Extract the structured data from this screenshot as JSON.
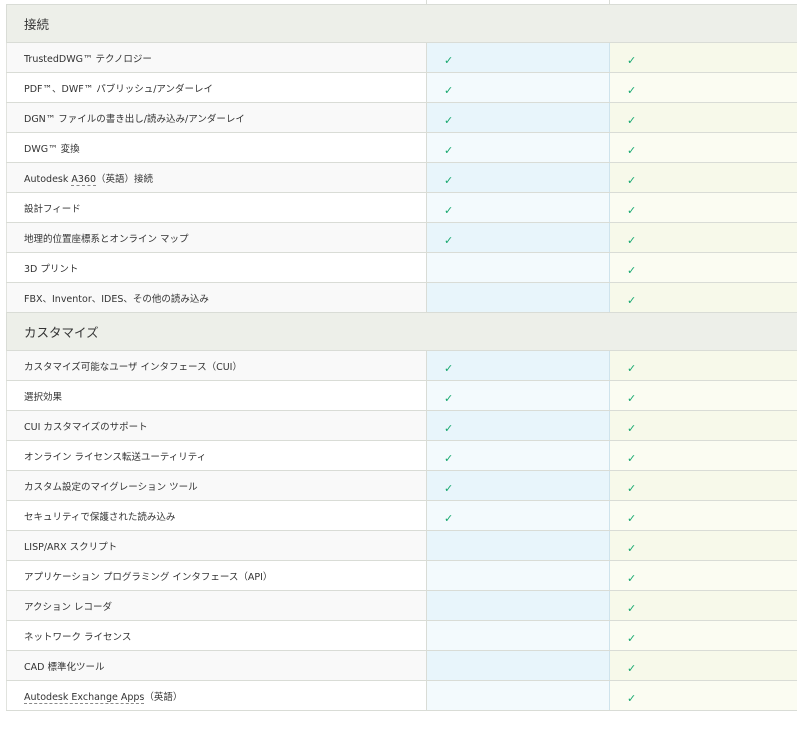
{
  "sections": [
    {
      "title": "接続",
      "rows": [
        {
          "label": "TrustedDWG™ テクノロジー",
          "lt": true,
          "full": true
        },
        {
          "label": "PDF™、DWF™ パブリッシュ/アンダーレイ",
          "lt": true,
          "full": true
        },
        {
          "label": "DGN™ ファイルの書き出し/読み込み/アンダーレイ",
          "lt": true,
          "full": true
        },
        {
          "label": "DWG™ 変換",
          "lt": true,
          "full": true
        },
        {
          "label_pre": "Autodesk ",
          "label_link": "A360",
          "label_post": "（英語）接続",
          "lt": true,
          "full": true
        },
        {
          "label": "設計フィード",
          "lt": true,
          "full": true
        },
        {
          "label": "地理的位置座標系とオンライン マップ",
          "lt": true,
          "full": true
        },
        {
          "label": "3D プリント",
          "lt": false,
          "full": true
        },
        {
          "label": "FBX、Inventor、IDES、その他の読み込み",
          "lt": false,
          "full": true
        }
      ]
    },
    {
      "title": "カスタマイズ",
      "rows": [
        {
          "label": "カスタマイズ可能なユーザ インタフェース（CUI）",
          "lt": true,
          "full": true
        },
        {
          "label": "選択効果",
          "lt": true,
          "full": true
        },
        {
          "label": "CUI カスタマイズのサポート",
          "lt": true,
          "full": true
        },
        {
          "label": "オンライン ライセンス転送ユーティリティ",
          "lt": true,
          "full": true
        },
        {
          "label": "カスタム設定のマイグレーション ツール",
          "lt": true,
          "full": true
        },
        {
          "label": "セキュリティで保護された読み込み",
          "lt": true,
          "full": true
        },
        {
          "label": "LISP/ARX スクリプト",
          "lt": false,
          "full": true
        },
        {
          "label": "アプリケーション プログラミング インタフェース（API）",
          "lt": false,
          "full": true
        },
        {
          "label": "アクション レコーダ",
          "lt": false,
          "full": true
        },
        {
          "label": "ネットワーク ライセンス",
          "lt": false,
          "full": true
        },
        {
          "label": "CAD 標準化ツール",
          "lt": false,
          "full": true
        },
        {
          "label_link": "Autodesk Exchange Apps",
          "label_post": "（英語）",
          "lt": false,
          "full": true
        }
      ]
    }
  ],
  "check_glyph": "✓",
  "icons": {
    "check": "check-icon"
  },
  "colors": {
    "check": "#17a86f",
    "section_bg": "#edefe9",
    "lt_col": "#f3fafd",
    "full_col": "#fbfcf2"
  }
}
